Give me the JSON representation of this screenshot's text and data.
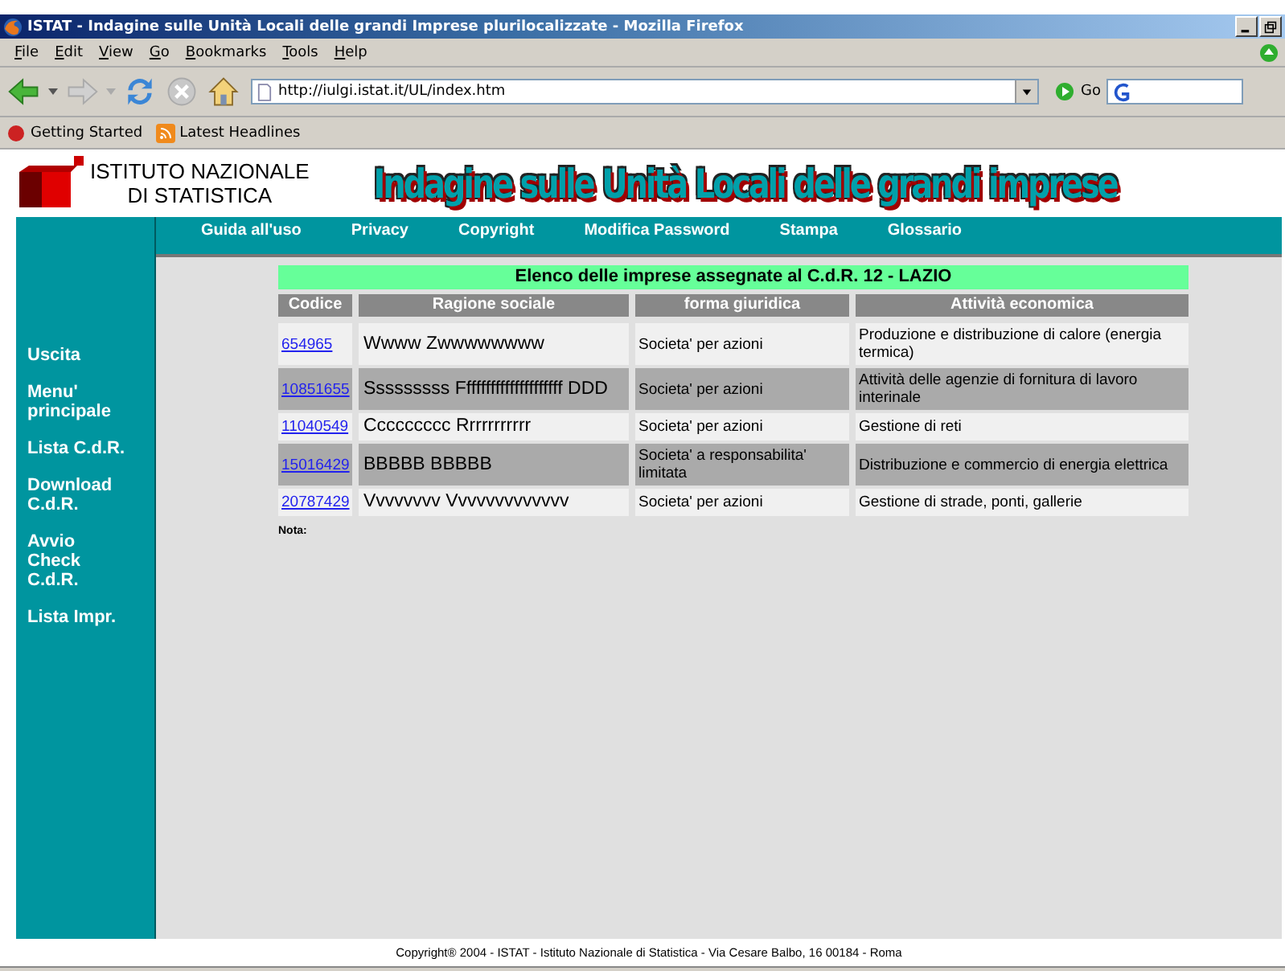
{
  "window": {
    "title": "ISTAT - Indagine sulle Unità Locali delle grandi Imprese plurilocalizzate - Mozilla Firefox"
  },
  "menu": [
    {
      "label": "File"
    },
    {
      "label": "Edit"
    },
    {
      "label": "View"
    },
    {
      "label": "Go"
    },
    {
      "label": "Bookmarks"
    },
    {
      "label": "Tools"
    },
    {
      "label": "Help"
    }
  ],
  "address": {
    "value": "http://iulgi.istat.it/UL/index.htm"
  },
  "go_button": "Go",
  "bookmarks": [
    "Getting Started",
    "Latest Headlines"
  ],
  "logo": {
    "line1": "ISTITUTO NAZIONALE",
    "line2": "DI STATISTICA"
  },
  "banner": "Indagine sulle Unità Locali delle grandi imprese",
  "top_nav": [
    "Guida all'uso",
    "Privacy",
    "Copyright",
    "Modifica Password",
    "Stampa",
    "Glossario"
  ],
  "sidebar": [
    "Uscita",
    "Menu' principale",
    "Lista C.d.R.",
    "Download C.d.R.",
    "Avvio Check C.d.R.",
    "Lista Impr."
  ],
  "table": {
    "title": "Elenco delle imprese assegnate al C.d.R. 12 - LAZIO",
    "columns": [
      "Codice",
      "Ragione sociale",
      "forma giuridica",
      "Attività economica"
    ],
    "rows": [
      {
        "codice": "654965",
        "ragione": "Wwww Zwwwwwwww",
        "forma": "Societa' per azioni",
        "attivita": "Produzione e distribuzione di calore (energia termica)"
      },
      {
        "codice": "10851655",
        "ragione": "Sssssssss Fffffffffffffffffffff DDD",
        "forma": "Societa' per azioni",
        "attivita": "Attività delle agenzie di fornitura di lavoro interinale"
      },
      {
        "codice": "11040549",
        "ragione": "Ccccccccc Rrrrrrrrrrr",
        "forma": "Societa' per azioni",
        "attivita": "Gestione di reti"
      },
      {
        "codice": "15016429",
        "ragione": "BBBBB BBBBB",
        "forma": "Societa' a responsabilita' limitata",
        "attivita": "Distribuzione e commercio di energia elettrica"
      },
      {
        "codice": "20787429",
        "ragione": "Vvvvvvvv Vvvvvvvvvvvvv",
        "forma": "Societa' per azioni",
        "attivita": "Gestione di strade, ponti, gallerie"
      }
    ]
  },
  "note": "Nota:",
  "footer": "Copyright® 2004 - ISTAT - Istituto Nazionale di Statistica - Via Cesare Balbo, 16 00184 - Roma"
}
